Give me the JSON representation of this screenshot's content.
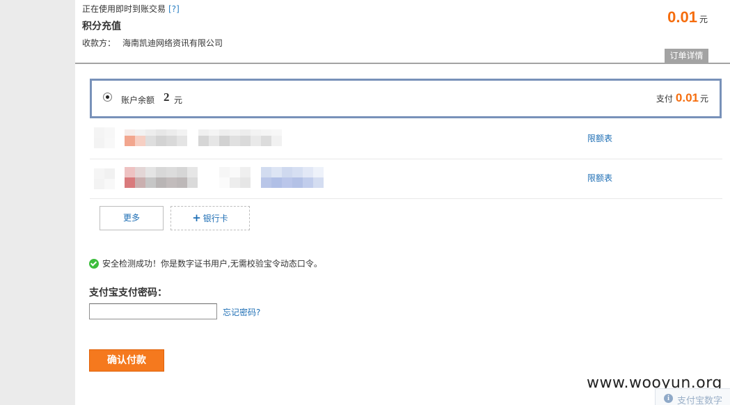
{
  "order": {
    "trade_type": "正在使用即时到账交易",
    "help_link": "[?]",
    "title": "积分充值",
    "payee_label": "收款方：",
    "payee_name": "海南凯迪网络资讯有限公司",
    "amount": "0.01",
    "currency": "元",
    "detail_tab": "订单详情"
  },
  "balance": {
    "label": "账户余额",
    "value": "2",
    "unit": "元",
    "pay_label": "支付",
    "pay_amount": "0.01",
    "pay_unit": "元",
    "selected": true
  },
  "bank_rows": [
    {
      "limit_link": "限额表"
    },
    {
      "limit_link": "限额表"
    }
  ],
  "buttons": {
    "more": "更多",
    "bank_card_plus": "+",
    "bank_card": "银行卡"
  },
  "security": {
    "message": "安全检测成功！你是数字证书用户,无需校验宝令动态口令。"
  },
  "password": {
    "label": "支付宝支付密码：",
    "value": "",
    "forgot": "忘记密码?"
  },
  "confirm": {
    "label": "确认付款"
  },
  "watermark": "www.wooyun.org",
  "cert_panel": {
    "icon_glyph": "i",
    "text": "支付宝数字"
  },
  "colors": {
    "accent_orange": "#f56d0e",
    "link_blue": "#1f6fb5",
    "selected_border": "#7891b9",
    "success_green": "#3dbd3d"
  },
  "icons": {
    "radio": "radio-selected-icon",
    "check": "check-circle-icon",
    "info": "info-icon",
    "plus": "plus-icon"
  }
}
